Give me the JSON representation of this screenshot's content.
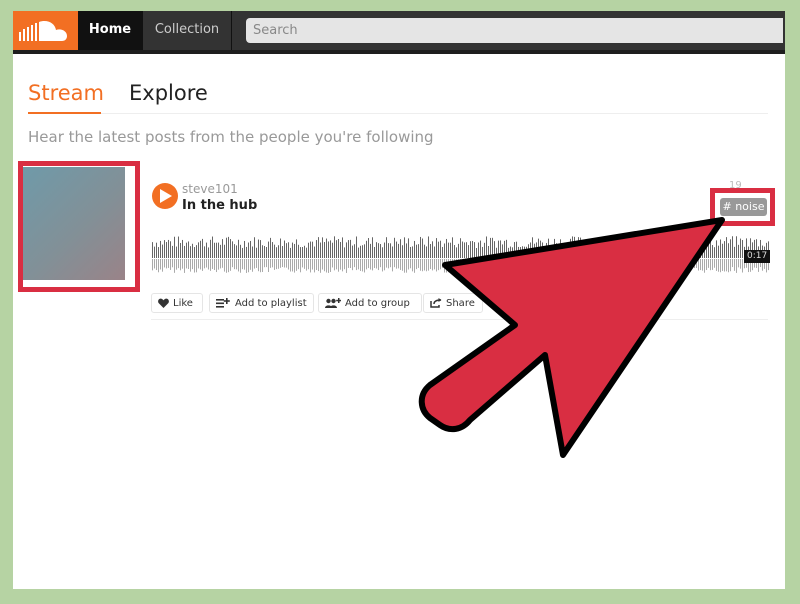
{
  "header": {
    "logo_icon": "soundcloud-cloud-icon",
    "nav": [
      {
        "label": "Home",
        "active": true
      },
      {
        "label": "Collection",
        "active": false
      }
    ],
    "search_placeholder": "Search"
  },
  "tabs": [
    {
      "label": "Stream",
      "active": true
    },
    {
      "label": "Explore",
      "active": false
    }
  ],
  "subtitle": "Hear the latest posts from the people you're following",
  "track": {
    "username": "steve101",
    "title": "In the hub",
    "posted": "19",
    "tag": "# noise",
    "duration": "0:17",
    "actions": [
      {
        "label": "Like",
        "icon": "heart-icon"
      },
      {
        "label": "Add to playlist",
        "icon": "add-to-playlist-icon"
      },
      {
        "label": "Add to group",
        "icon": "add-to-group-icon"
      },
      {
        "label": "Share",
        "icon": "share-icon"
      }
    ]
  },
  "colors": {
    "brand_orange": "#f26f23",
    "highlight_red": "#d92e42",
    "header_dark": "#333333"
  }
}
